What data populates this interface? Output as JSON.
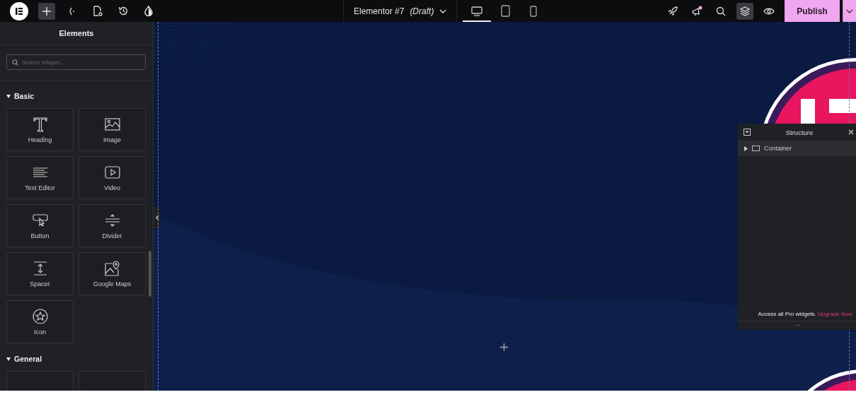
{
  "toolbar": {
    "document_title": "Elementor #7 *(Draft)*",
    "devices": [
      {
        "kind": "desktop",
        "selected": true
      },
      {
        "kind": "tablet",
        "selected": false
      },
      {
        "kind": "mobile",
        "selected": false
      }
    ],
    "notification": true,
    "publish": "Publish"
  },
  "sidebar": {
    "title": "Elements",
    "search": {
      "placeholder": "Search Widget..."
    },
    "categories": [
      {
        "name": "Basic",
        "expanded": true,
        "widgets": [
          {
            "kind": "heading",
            "label": "Heading"
          },
          {
            "kind": "image",
            "label": "Image"
          },
          {
            "kind": "text",
            "label": "Text Editor"
          },
          {
            "kind": "video",
            "label": "Video"
          },
          {
            "kind": "button",
            "label": "Button"
          },
          {
            "kind": "divider",
            "label": "Divider"
          },
          {
            "kind": "spacer",
            "label": "Spacer"
          },
          {
            "kind": "map",
            "label": "Google Maps"
          },
          {
            "kind": "icon",
            "label": "Icon"
          }
        ]
      },
      {
        "name": "General",
        "expanded": true,
        "widgets": [
          {
            "kind": "blank"
          },
          {
            "kind": "blank"
          }
        ]
      }
    ]
  },
  "structure": {
    "title": "Structure",
    "items": [
      {
        "label": "Container",
        "expanded": false
      }
    ],
    "promo": "Access all Pro widgets.",
    "promo_link": "Upgrade Now",
    "more": "..."
  }
}
